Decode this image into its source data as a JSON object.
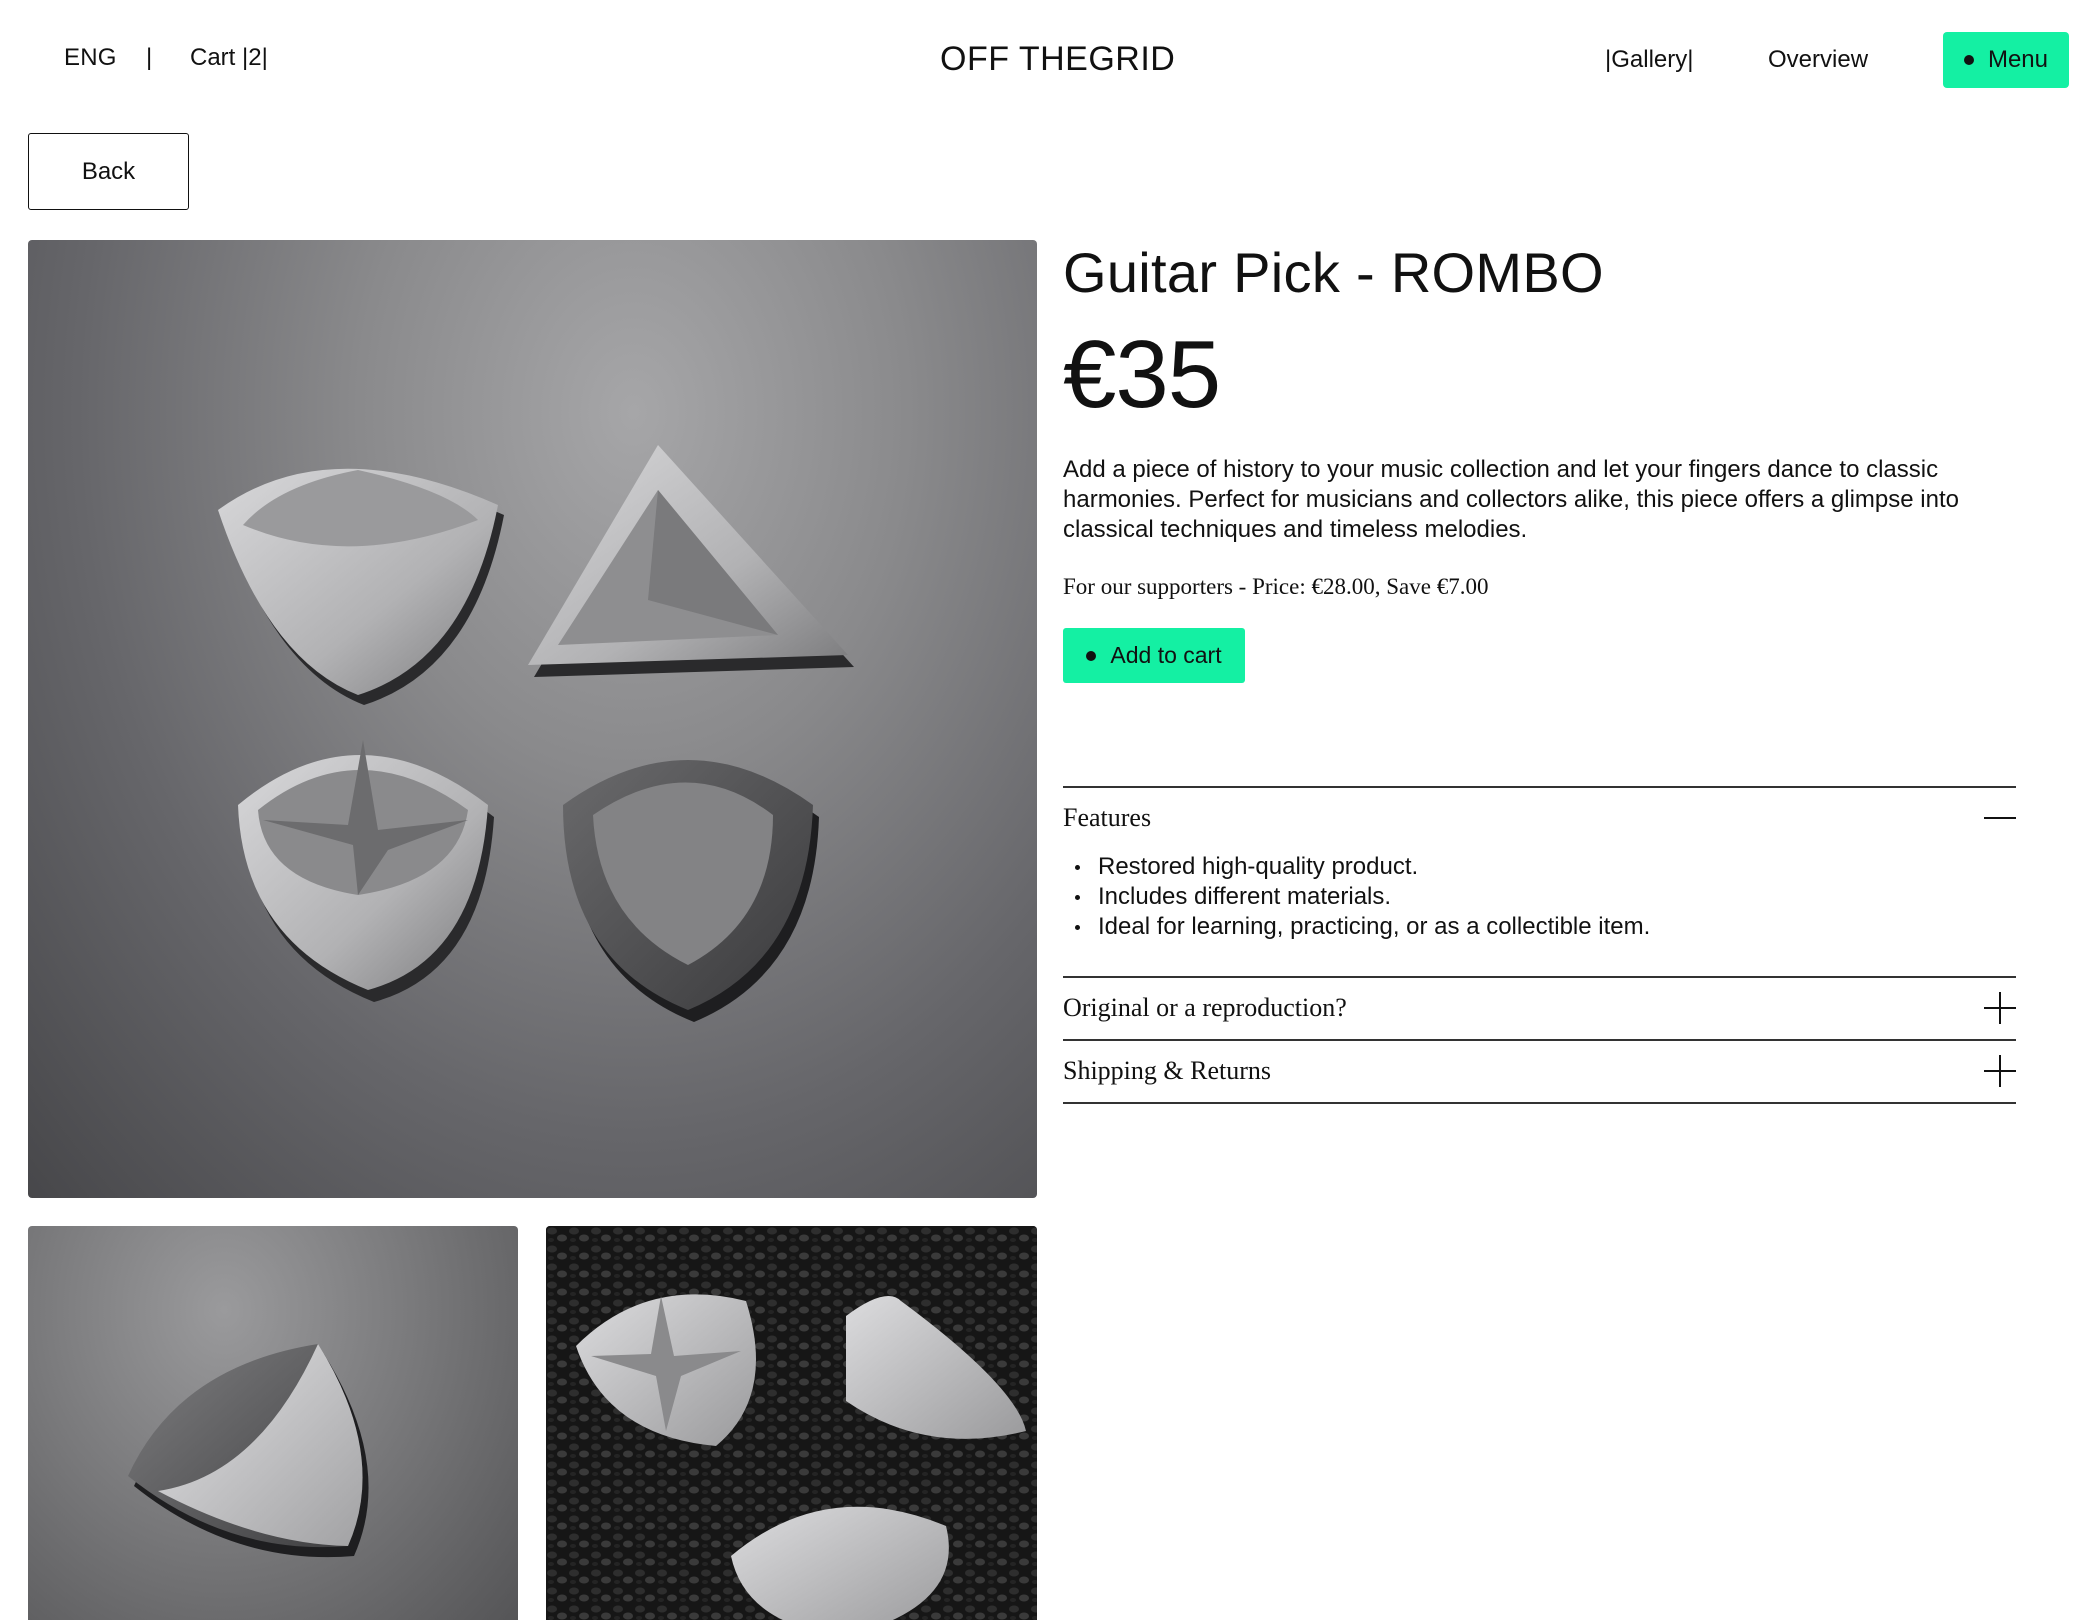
{
  "header": {
    "language": "ENG",
    "separator": "|",
    "cart_label": "Cart |2|",
    "logo": "OFF THEGRID",
    "nav": {
      "gallery": "|Gallery|",
      "overview": "Overview",
      "menu": "Menu"
    }
  },
  "back_label": "Back",
  "product": {
    "title": "Guitar Pick - ROMBO",
    "price": "€35",
    "description": "Add a piece of history to your music collection and let your fingers dance to classic harmonies. Perfect for musicians and collectors alike, this piece offers a glimpse into classical techniques and timeless melodies.",
    "supporters_price": "For our supporters - Price: €28.00, Save €7.00",
    "add_to_cart_label": "Add to cart"
  },
  "accordion": {
    "features": {
      "title": "Features",
      "expanded": true,
      "items": [
        "Restored high-quality product.",
        "Includes different materials.",
        "Ideal for learning, practicing, or as a collectible item."
      ]
    },
    "original": {
      "title": "Original or a reproduction?",
      "expanded": false
    },
    "shipping": {
      "title": "Shipping & Returns",
      "expanded": false
    }
  },
  "colors": {
    "accent": "#14f0a3",
    "text": "#111111",
    "background": "#ffffff"
  },
  "images": {
    "main": "four-guitar-picks-on-grey-surface",
    "thumb1": "single-guitar-pick-closeup",
    "thumb2": "guitar-picks-on-black-granules"
  }
}
